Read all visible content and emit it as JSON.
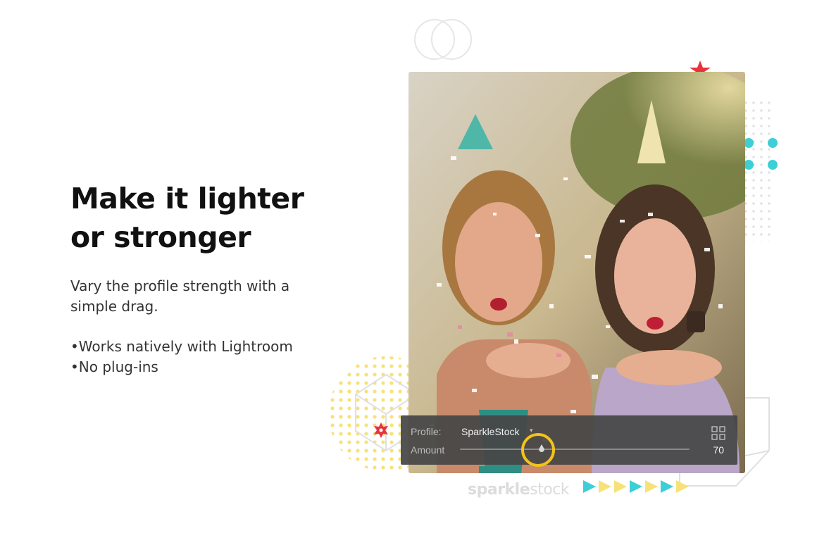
{
  "headline": {
    "line1": "Make it lighter",
    "line2": "or stronger"
  },
  "description": {
    "line1": "Vary the profile strength with a",
    "line2": "simple drag."
  },
  "bullets": [
    "Works natively with Lightroom",
    "No plug-ins"
  ],
  "profile_panel": {
    "profile_label": "Profile:",
    "profile_value": "SparkleStock",
    "amount_label": "Amount",
    "amount_value": "70",
    "grid_icon": "grid-view-icon"
  },
  "brand": {
    "word_bold": "sparkle",
    "word_light": "stock"
  },
  "colors": {
    "text_dark": "#111111",
    "text_body": "#333333",
    "panel_bg": "#464646",
    "highlight_ring": "#f2c318",
    "accent_cyan": "#3ecfd6",
    "accent_yellow": "#f7e27a",
    "accent_red": "#e8323c"
  }
}
